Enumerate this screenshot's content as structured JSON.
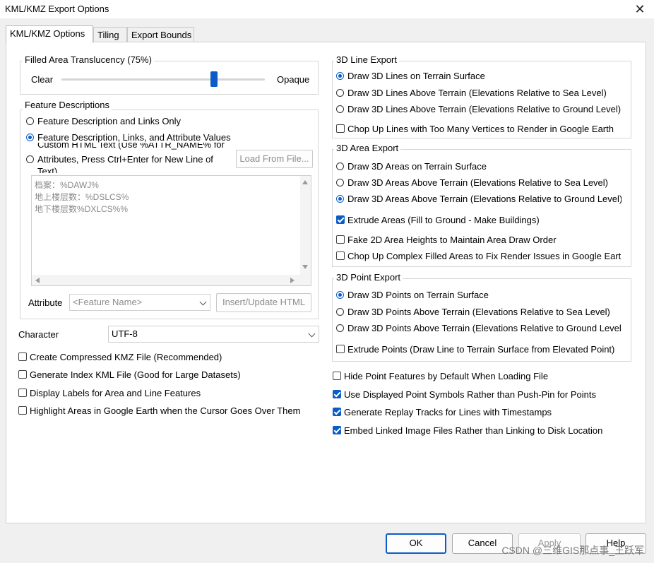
{
  "window": {
    "title": "KML/KMZ Export Options",
    "close_glyph": "✕"
  },
  "tabs": [
    {
      "label": "KML/KMZ Options",
      "active": true
    },
    {
      "label": "Tiling",
      "active": false
    },
    {
      "label": "Export Bounds",
      "active": false
    }
  ],
  "translucency": {
    "title": "Filled Area Translucency (75%)",
    "left_label": "Clear",
    "right_label": "Opaque",
    "value_percent": 75
  },
  "feature_descriptions": {
    "title": "Feature Descriptions",
    "options": [
      {
        "label": "Feature Description and Links Only",
        "selected": false
      },
      {
        "label": "Feature Description, Links, and Attribute Values",
        "selected": true
      },
      {
        "label_top": "Custom HTML Text (Use %ATTR_NAME% for",
        "label_main": "Attributes, Press Ctrl+Enter for New Line of",
        "label_bottom": "Text)",
        "selected": false
      }
    ],
    "load_button": "Load From File...",
    "html_lines": [
      "档案：%DAWJ%",
      "地上楼层数：%DSLCS%",
      "地下楼层数%DXLCS%%"
    ],
    "attribute_label": "Attribute",
    "attribute_value": "<Feature Name>",
    "insert_button": "Insert/Update HTML"
  },
  "character": {
    "label": "Character",
    "value": "UTF-8"
  },
  "left_checks": [
    {
      "label": "Create Compressed KMZ File (Recommended)",
      "checked": false
    },
    {
      "label": "Generate Index KML File (Good for Large Datasets)",
      "checked": false
    },
    {
      "label": "Display Labels for Area and Line Features",
      "checked": false
    },
    {
      "label": "Highlight Areas in Google Earth when the Cursor Goes Over Them",
      "checked": false
    }
  ],
  "line_export": {
    "title": "3D Line Export",
    "options": [
      {
        "label": "Draw 3D Lines on Terrain Surface",
        "selected": true
      },
      {
        "label": "Draw 3D Lines Above Terrain (Elevations Relative to Sea Level)",
        "selected": false
      },
      {
        "label": "Draw 3D Lines Above Terrain (Elevations Relative to Ground Level)",
        "selected": false
      }
    ],
    "chop_check": {
      "label": "Chop Up Lines with Too Many Vertices to Render in Google Earth",
      "checked": false
    }
  },
  "area_export": {
    "title": "3D Area Export",
    "options": [
      {
        "label": "Draw 3D Areas on Terrain Surface",
        "selected": false
      },
      {
        "label": "Draw 3D Areas Above Terrain (Elevations Relative to Sea Level)",
        "selected": false
      },
      {
        "label": "Draw 3D Areas Above Terrain (Elevations Relative to Ground Level)",
        "selected": true
      }
    ],
    "checks": [
      {
        "label": "Extrude Areas (Fill to Ground - Make Buildings)",
        "checked": true
      },
      {
        "label": "Fake 2D Area Heights to Maintain Area Draw Order",
        "checked": false
      },
      {
        "label": "Chop Up Complex Filled Areas to Fix Render Issues in Google Eart",
        "checked": false
      }
    ]
  },
  "point_export": {
    "title": "3D Point Export",
    "options": [
      {
        "label": "Draw 3D Points on Terrain Surface",
        "selected": true
      },
      {
        "label": "Draw 3D Points Above Terrain (Elevations Relative to Sea Level)",
        "selected": false
      },
      {
        "label": "Draw 3D Points Above Terrain (Elevations Relative to Ground Level",
        "selected": false
      }
    ],
    "extrude_check": {
      "label": "Extrude Points (Draw Line to Terrain Surface from Elevated Point)",
      "checked": false
    }
  },
  "right_checks": [
    {
      "label": "Hide Point Features by Default When Loading File",
      "checked": false
    },
    {
      "label": "Use Displayed Point Symbols Rather than Push-Pin for Points",
      "checked": true
    },
    {
      "label": "Generate Replay Tracks for Lines with Timestamps",
      "checked": true
    },
    {
      "label": "Embed Linked Image Files Rather than Linking to Disk Location",
      "checked": true
    }
  ],
  "buttons": {
    "ok": "OK",
    "cancel": "Cancel",
    "apply": "Apply",
    "help": "Help"
  },
  "watermark": "CSDN @三维GIS那点事_王跃军",
  "colors": {
    "accent": "#0a5cc7",
    "panel": "#ffffff",
    "chrome": "#f0f0f0"
  }
}
